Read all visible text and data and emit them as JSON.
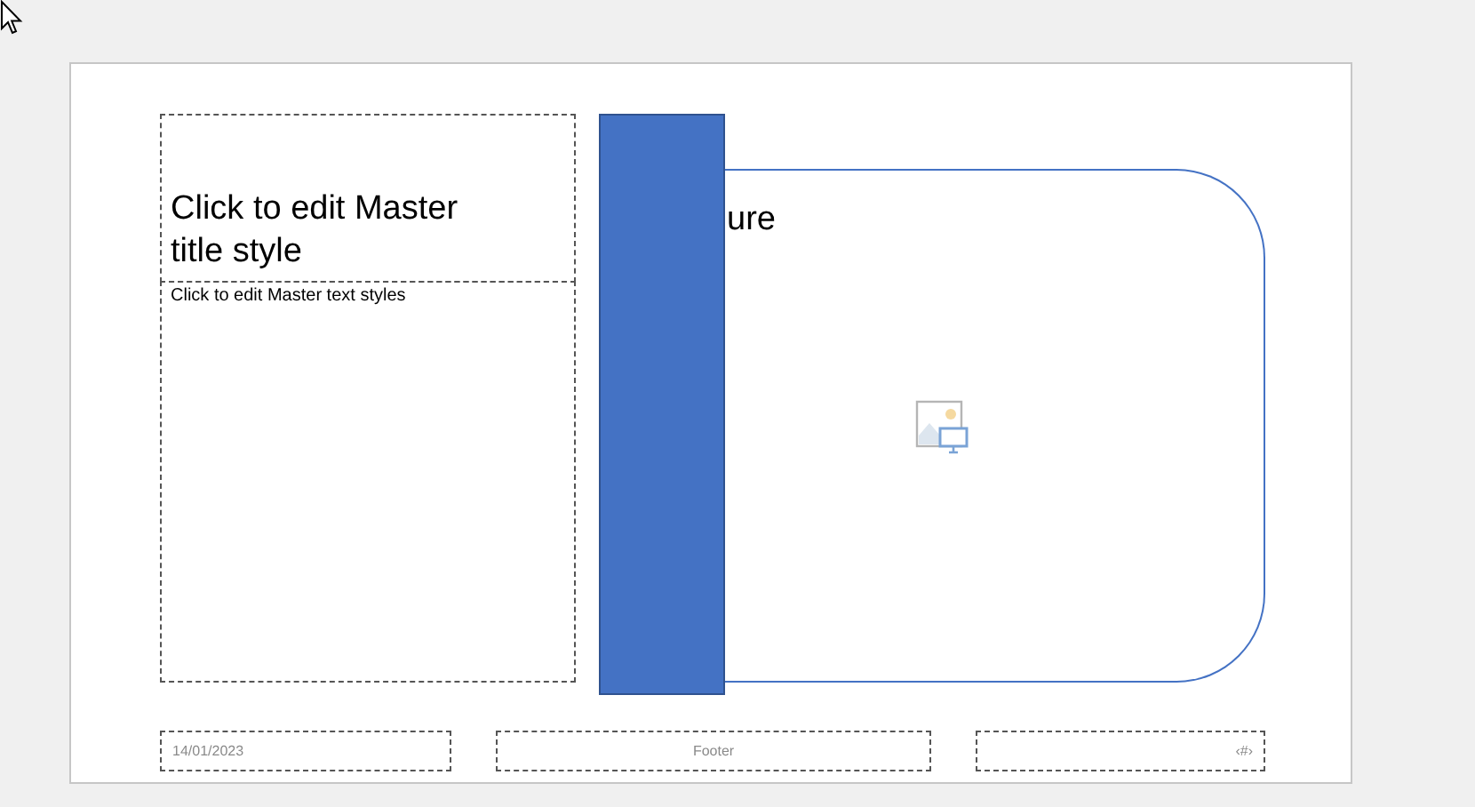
{
  "slide": {
    "title_placeholder": {
      "text": "Click to edit Master title style"
    },
    "body_placeholder": {
      "text": "Click to edit Master text styles"
    },
    "picture_placeholder": {
      "text": "ure"
    },
    "footer": {
      "date": "14/01/2023",
      "footer": "Footer",
      "slide_number": "‹#›"
    }
  }
}
